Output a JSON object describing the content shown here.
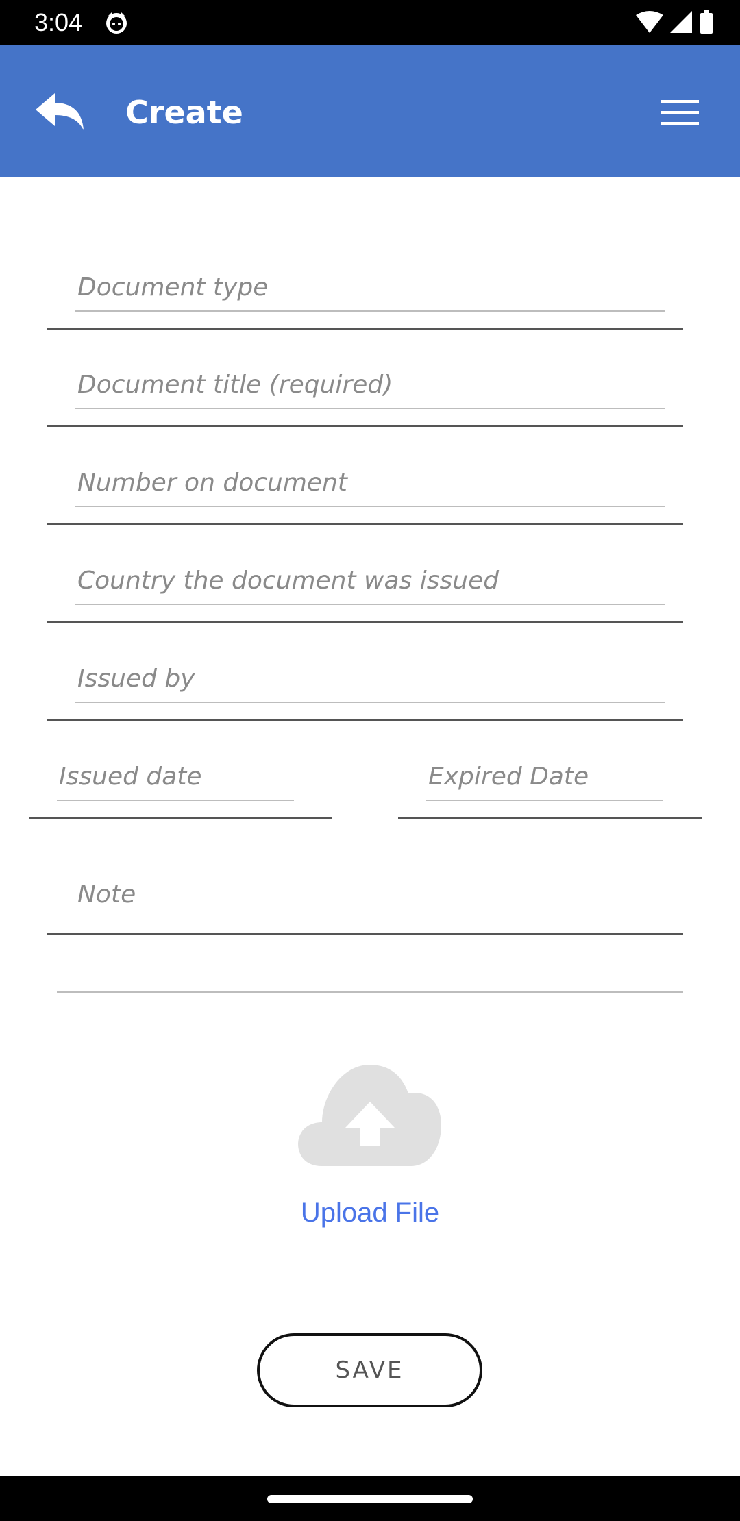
{
  "status_bar": {
    "time": "3:04",
    "icons": [
      "notification-cat-icon",
      "wifi-icon",
      "signal-icon",
      "battery-icon"
    ]
  },
  "app_bar": {
    "title": "Create",
    "back_icon": "reply-arrow-icon",
    "menu_icon": "hamburger-menu-icon",
    "color": "#4574c8"
  },
  "form": {
    "document_type": {
      "placeholder": "Document type",
      "value": ""
    },
    "document_title": {
      "placeholder": "Document title (required)",
      "value": ""
    },
    "number": {
      "placeholder": "Number on document",
      "value": ""
    },
    "country": {
      "placeholder": "Country the document was issued",
      "value": ""
    },
    "issued_by": {
      "placeholder": "Issued by",
      "value": ""
    },
    "issued_date": {
      "placeholder": "Issued date",
      "value": ""
    },
    "expired_date": {
      "placeholder": "Expired Date",
      "value": ""
    },
    "note": {
      "placeholder": "Note",
      "value": ""
    }
  },
  "upload": {
    "icon": "cloud-upload-icon",
    "label": "Upload File",
    "color": "#4a74e8"
  },
  "save_button": {
    "label": "SAVE"
  }
}
